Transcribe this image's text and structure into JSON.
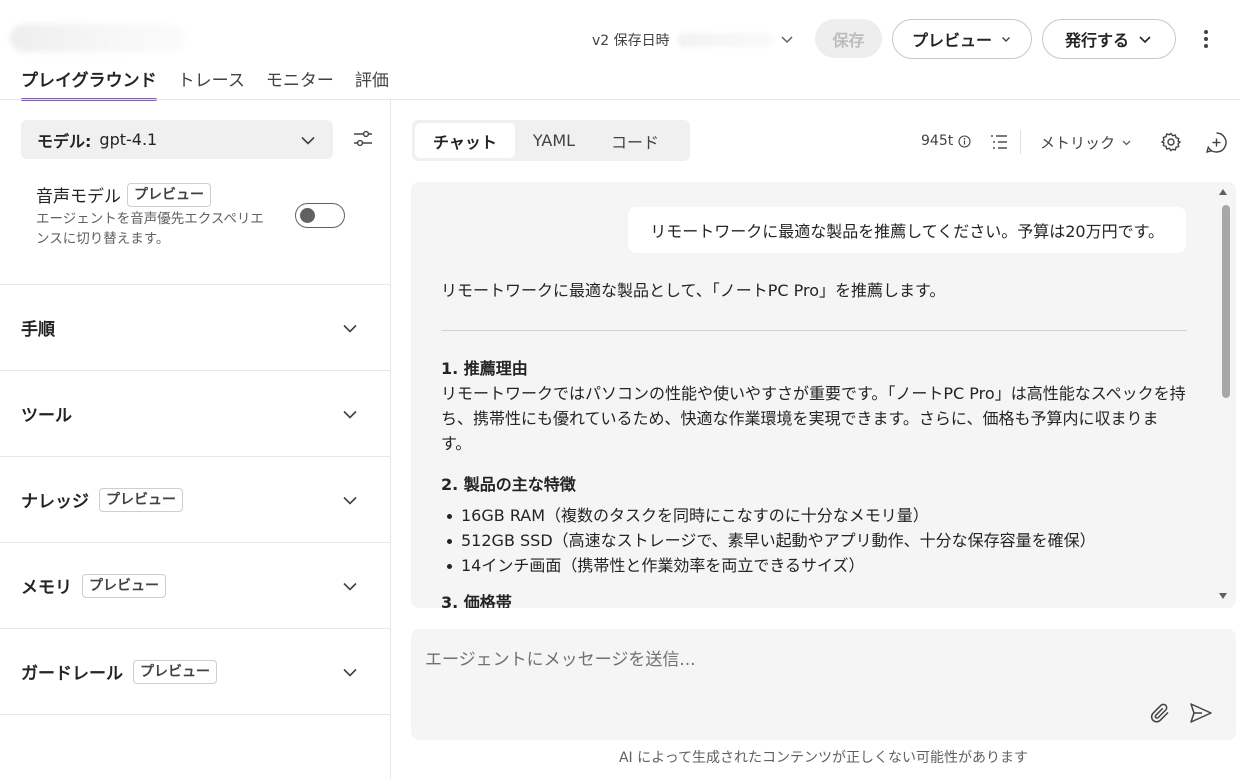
{
  "header": {
    "version_label": "v2 保存日時",
    "save_label": "保存",
    "preview_label": "プレビュー",
    "publish_label": "発行する"
  },
  "tabs": [
    {
      "label": "プレイグラウンド",
      "active": true
    },
    {
      "label": "トレース"
    },
    {
      "label": "モニター"
    },
    {
      "label": "評価"
    }
  ],
  "left": {
    "model_label": "モデル:",
    "model_value": "gpt-4.1",
    "voice_title": "音声モデル",
    "voice_badge": "プレビュー",
    "voice_desc": "エージェントを音声優先エクスペリエンスに切り替えます。",
    "voice_enabled": false,
    "sections": [
      {
        "title": "手順"
      },
      {
        "title": "ツール"
      },
      {
        "title": "ナレッジ",
        "badge": "プレビュー"
      },
      {
        "title": "メモリ",
        "badge": "プレビュー"
      },
      {
        "title": "ガードレール",
        "badge": "プレビュー"
      }
    ]
  },
  "right": {
    "mode_tabs": [
      "チャット",
      "YAML",
      "コード"
    ],
    "tokens": "945t",
    "metrics_label": "メトリック",
    "user_message": "リモートワークに最適な製品を推薦してください。予算は20万円です。",
    "reply_intro": "リモートワークに最適な製品として、「ノートPC Pro」を推薦します。",
    "h1": "1. 推薦理由",
    "p1": "リモートワークではパソコンの性能や使いやすさが重要です。「ノートPC Pro」は高性能なスペックを持ち、携帯性にも優れているため、快適な作業環境を実現できます。さらに、価格も予算内に収まります。",
    "h2": "2. 製品の主な特徴",
    "features": [
      "16GB RAM（複数のタスクを同時にこなすのに十分なメモリ量）",
      "512GB SSD（高速なストレージで、素早い起動やアプリ動作、十分な保存容量を確保）",
      "14インチ画面（携帯性と作業効率を両立できるサイズ）"
    ],
    "h3": "3. 価格帯",
    "composer_placeholder": "エージェントにメッセージを送信...",
    "disclaimer": "AI によって生成されたコンテンツが正しくない可能性があります"
  },
  "colors": {
    "accent": "#8a52d6",
    "panel": "#f5f5f5"
  }
}
